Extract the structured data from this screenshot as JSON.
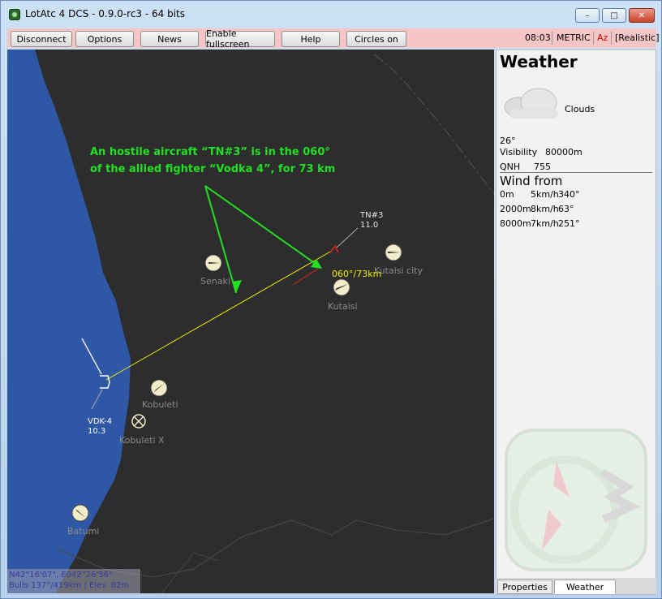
{
  "window": {
    "title": "LotAtc 4 DCS - 0.9.0-rc3 - 64 bits",
    "minimize": "–",
    "maximize": "□",
    "close": "✕"
  },
  "toolbar": {
    "buttons": [
      "Disconnect",
      "Options",
      "News",
      "Enable fullscreen",
      "Help",
      "Circles on"
    ],
    "time": "08:03",
    "units": "METRIC",
    "az": "Az",
    "mode": "[Realistic]"
  },
  "map": {
    "annotation_line1": "An hostile aircraft “TN#3” is in the 060°",
    "annotation_line2": "of the allied fighter “Vodka 4”, for 73 km",
    "bearing_label": "060°/73km",
    "contacts": [
      {
        "callsign": "TN#3",
        "altitude": "11.0"
      },
      {
        "callsign": "VDK-4",
        "altitude": "10.3"
      }
    ],
    "airfields": [
      "Senaki",
      "Kutaisi",
      "Kutaisi city",
      "Kobuleti",
      "Kobuleti X",
      "Batumi"
    ],
    "colors": {
      "sea": "#2e57a6",
      "land": "#2d2d2d",
      "annotation": "#22e022",
      "bearing": "#f2f200",
      "hostile": "#e02020"
    }
  },
  "coords": {
    "position": "N42°16'07\", E042°26'56\"",
    "bulls": "Bulls 137°/419km | Elev. 82m"
  },
  "weather": {
    "title": "Weather",
    "condition": "Clouds",
    "icon": "cloud-icon",
    "temperature": "26°",
    "visibility_label": "Visibility",
    "visibility": "80000m",
    "qnh_label": "QNH",
    "qnh": "755",
    "wind_title": "Wind from",
    "wind": [
      {
        "alt": "0m",
        "speed": "5km/h",
        "dir": "340°"
      },
      {
        "alt": "2000m",
        "speed": "8km/h",
        "dir": "63°"
      },
      {
        "alt": "8000m",
        "speed": "7km/h",
        "dir": "251°"
      }
    ]
  },
  "tabs": [
    "Properties",
    "Weather"
  ]
}
